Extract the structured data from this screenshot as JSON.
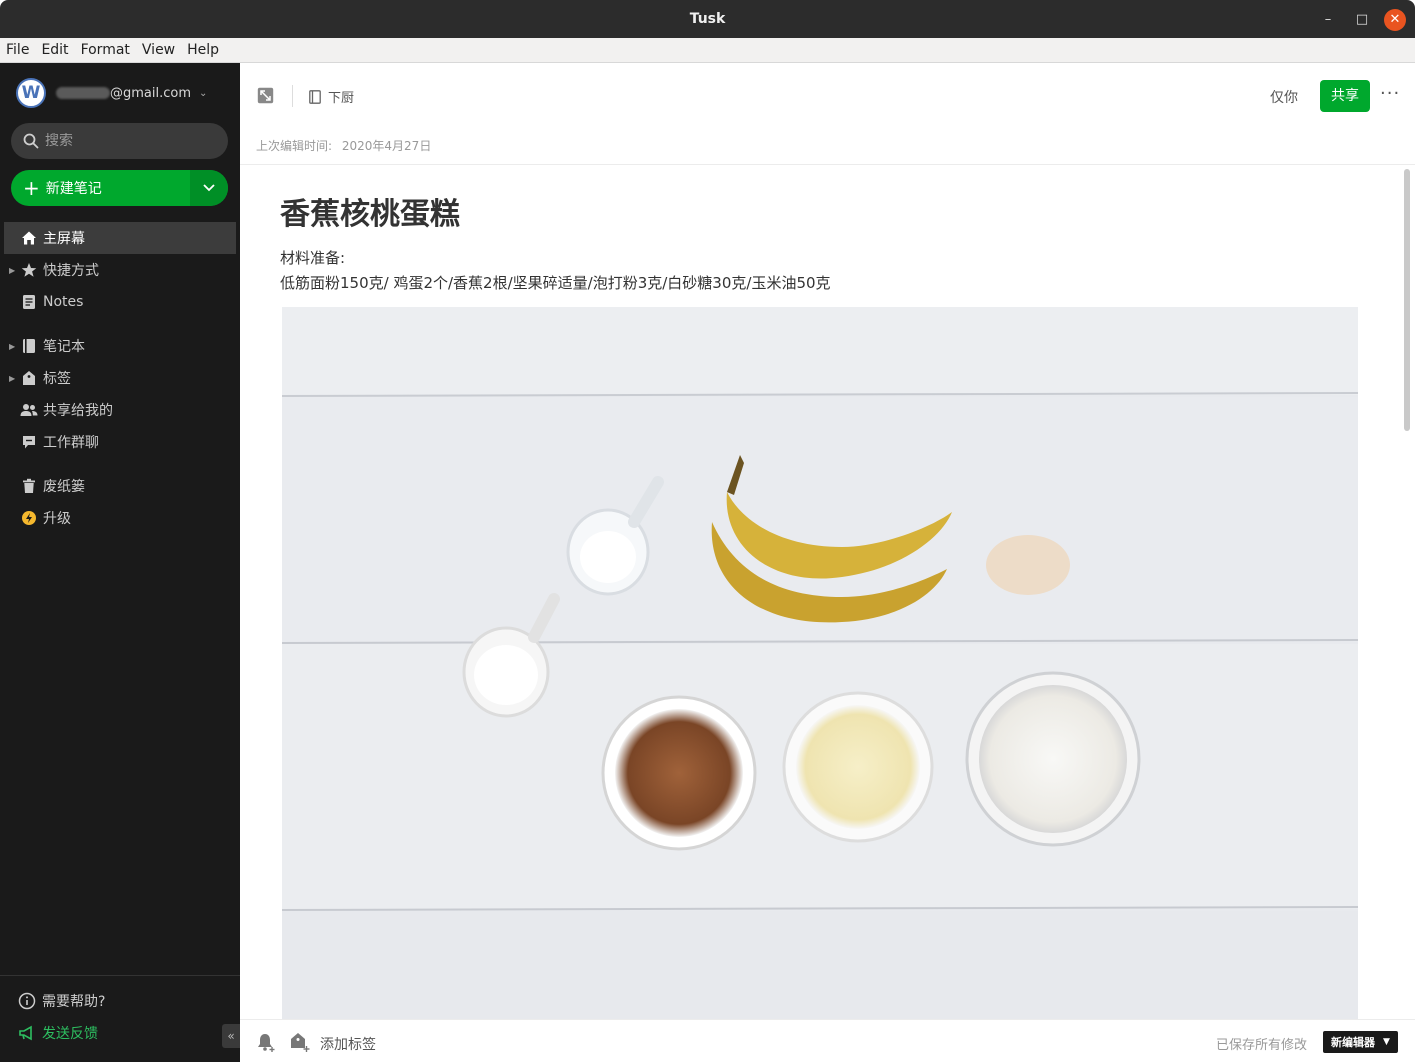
{
  "window": {
    "title": "Tusk",
    "controls": {
      "minimize": "–",
      "maximize": "□",
      "close": "✕"
    }
  },
  "menubar": [
    "File",
    "Edit",
    "Format",
    "View",
    "Help"
  ],
  "sidebar": {
    "account": {
      "avatar_letter": "W",
      "email_visible": "@gmail.com"
    },
    "search_placeholder": "搜索",
    "new_note_label": "新建笔记",
    "items": [
      {
        "label": "主屏幕",
        "icon": "home-icon",
        "active": true
      },
      {
        "label": "快捷方式",
        "icon": "star-icon",
        "expandable": true
      },
      {
        "label": "Notes",
        "icon": "note-icon"
      },
      {
        "label": "笔记本",
        "icon": "notebook-icon",
        "expandable": true
      },
      {
        "label": "标签",
        "icon": "tag-icon",
        "expandable": true
      },
      {
        "label": "共享给我的",
        "icon": "shared-users-icon"
      },
      {
        "label": "工作群聊",
        "icon": "chat-icon"
      },
      {
        "label": "废纸篓",
        "icon": "trash-icon"
      },
      {
        "label": "升级",
        "icon": "upgrade-icon"
      }
    ],
    "help_label": "需要帮助?",
    "feedback_label": "发送反馈",
    "collapse_glyph": "«"
  },
  "note": {
    "notebook": "下厨",
    "visibility": "仅你",
    "share_label": "共享",
    "more_glyph": "···",
    "last_edit_label": "上次编辑时间:",
    "last_edit_date": "2020年4月27日",
    "title": "香蕉核桃蛋糕",
    "body_line1": "材料准备:",
    "body_line2": "低筋面粉150克/ 鸡蛋2个/香蕉2根/坚果碎适量/泡打粉3克/白砂糖30克/玉米油50克"
  },
  "footer": {
    "add_tag_label": "添加标签",
    "saved_status": "已保存所有修改",
    "new_editor_label": "新编辑器"
  },
  "colors": {
    "sidebar_bg": "#1a1a1a",
    "accent_green": "#00a82d",
    "active_item_bg": "#3c3c3c",
    "close_button": "#e95420"
  }
}
